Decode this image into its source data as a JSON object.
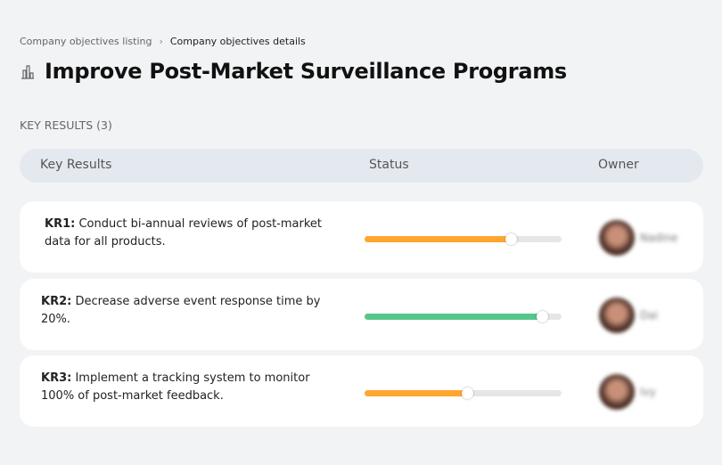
{
  "breadcrumb": {
    "parent": "Company objectives listing",
    "separator": "›",
    "current": "Company objectives details"
  },
  "page": {
    "title": "Improve Post-Market Surveillance Programs",
    "icon": "building-chart-icon",
    "section": "KEY RESULTS (3)"
  },
  "table": {
    "headers": [
      "Key Results",
      "Status",
      "Owner"
    ],
    "rows": [
      {
        "id": "KR1:",
        "text": " Conduct bi-annual reviews of post-market data for all products.",
        "progress": 74,
        "color": "#ffa630",
        "owner": "Nadine"
      },
      {
        "id": "KR2:",
        "text": " Decrease adverse event response time by 20%.",
        "progress": 90,
        "color": "#58c68b",
        "owner": "Dai"
      },
      {
        "id": "KR3:",
        "text": " Implement a tracking system to monitor 100% of post-market feedback.",
        "progress": 52,
        "color": "#ffa630",
        "owner": "Ivy"
      }
    ]
  }
}
